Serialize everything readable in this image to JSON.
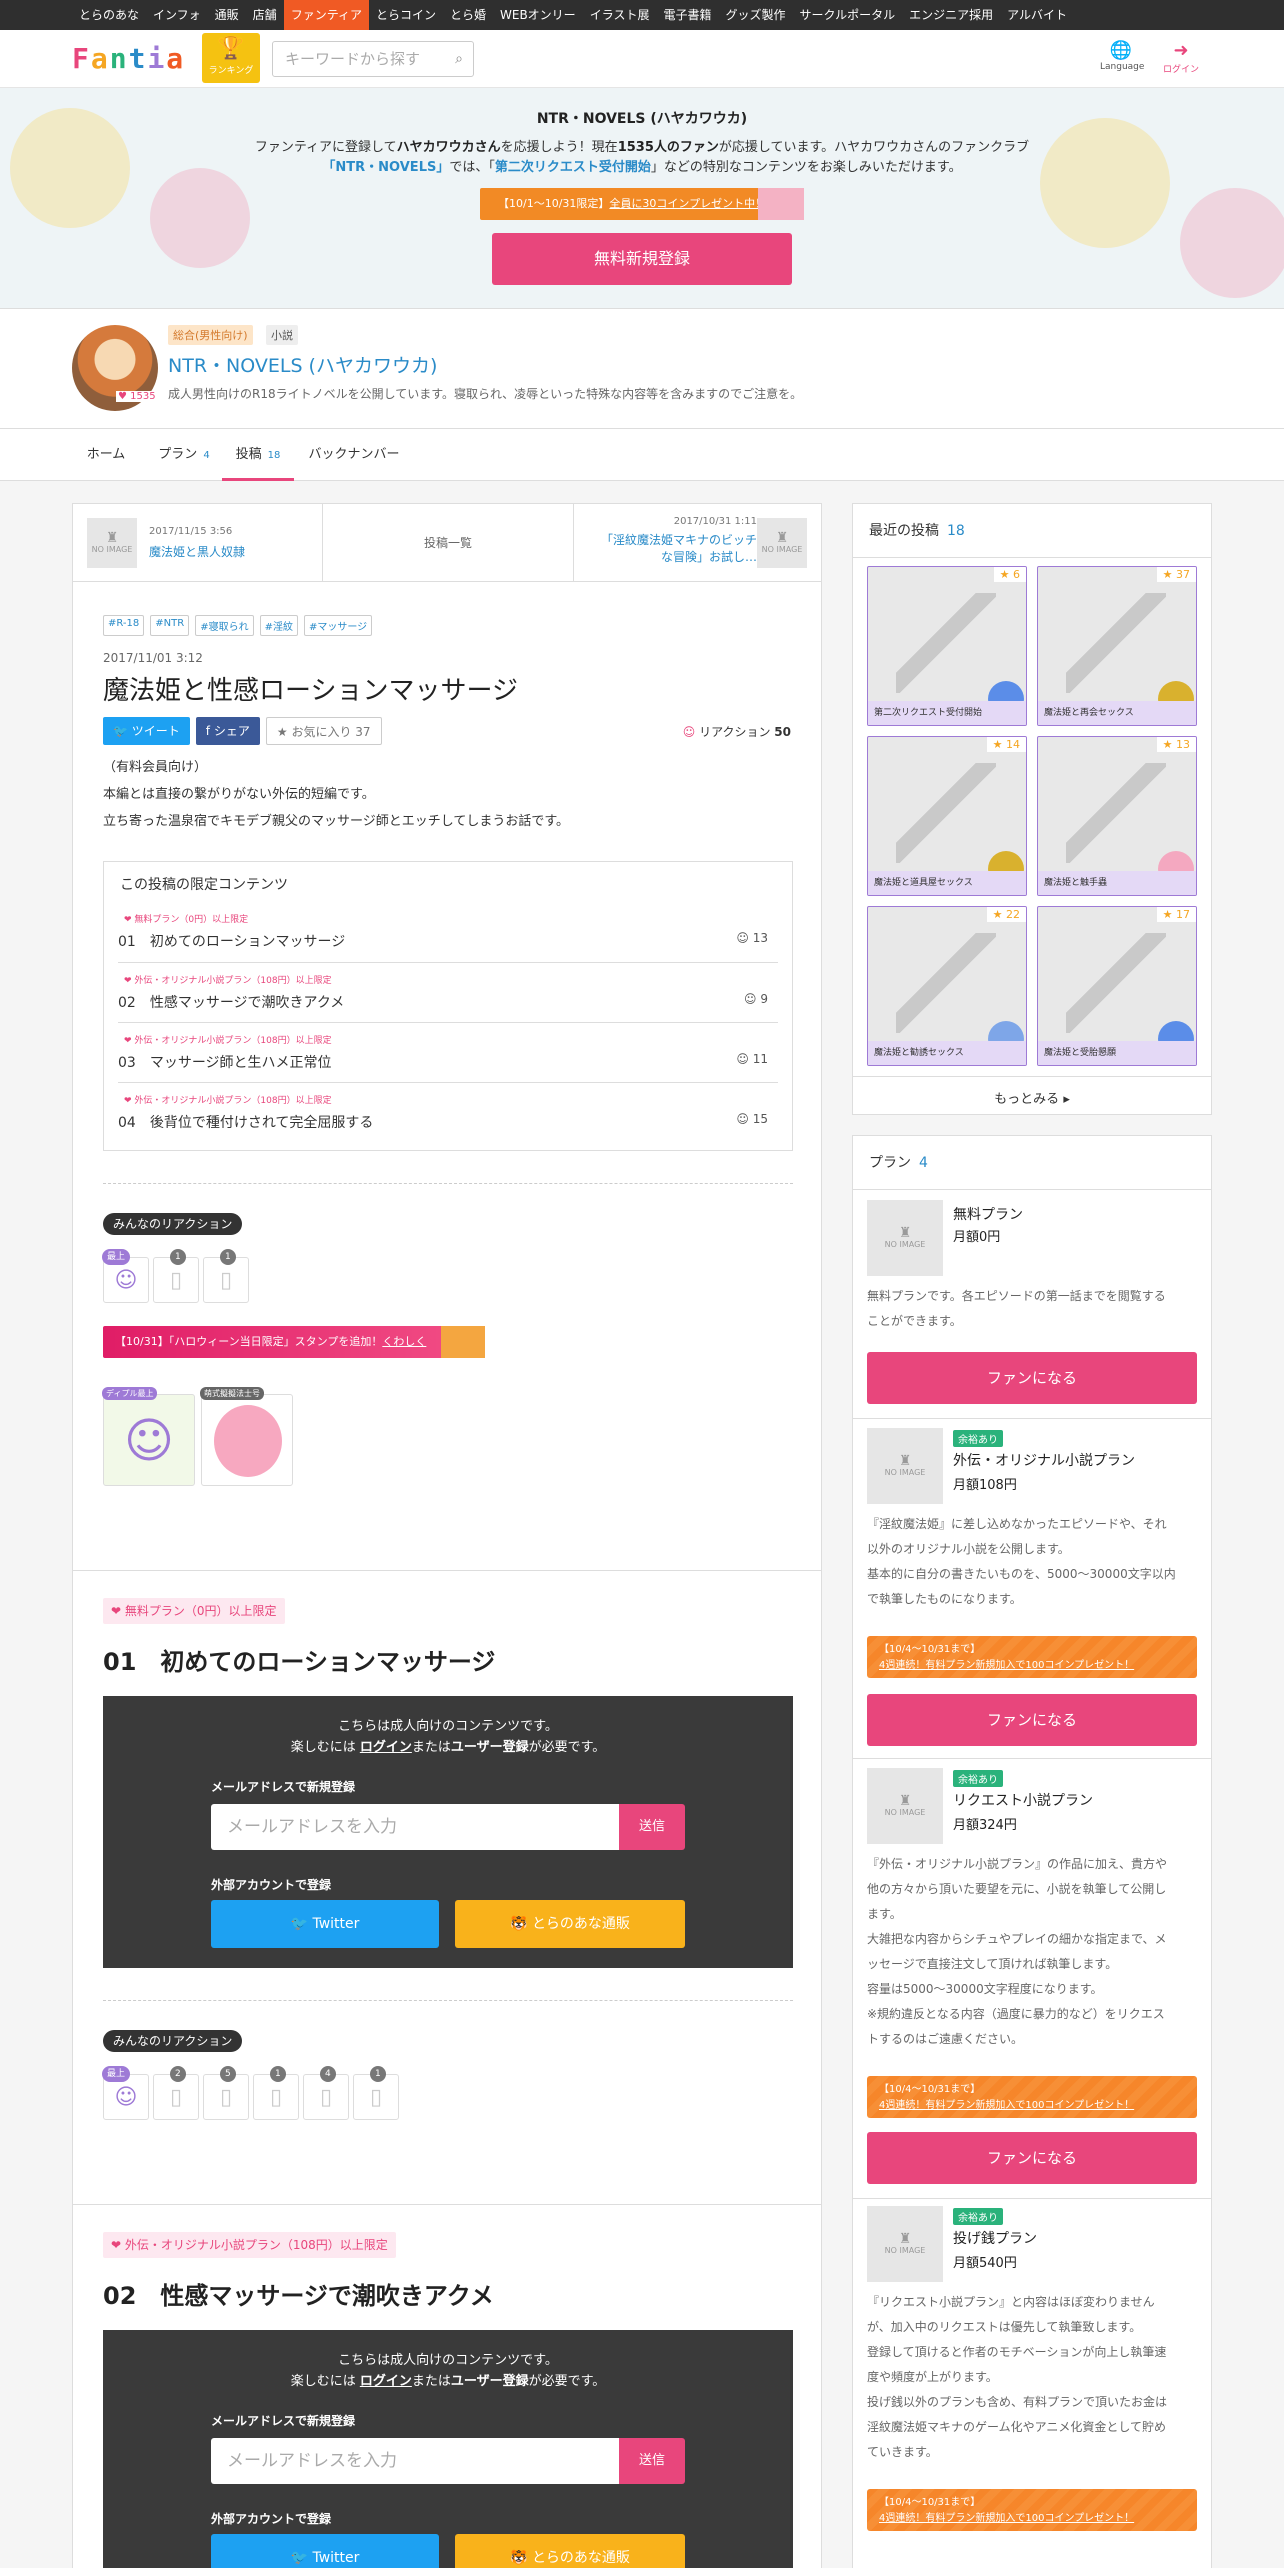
{
  "topnav": [
    "とらのあな",
    "インフォ",
    "通販",
    "店舗",
    "ファンティア",
    "とらコイン",
    "とら婚",
    "WEBオンリー",
    "イラスト展",
    "電子書籍",
    "グッズ製作",
    "サークルポータル",
    "エンジニア採用",
    "アルバイト"
  ],
  "header": {
    "logo": "Fantia",
    "ranking": "ランキング",
    "search_placeholder": "キーワードから探す",
    "language": "Language",
    "login": "ログイン"
  },
  "hero": {
    "title": "NTR・NOVELS (ハヤカワウカ)",
    "line1_a": "ファンティアに登録して",
    "line1_b": "ハヤカワウカさん",
    "line1_c": "を応援しよう！現在",
    "line1_d": "1535人のファン",
    "line1_e": "が応援しています。ハヤカワウカさんのファンクラブ",
    "line2_a": "「NTR・NOVELS」",
    "line2_b": "では、「",
    "line2_c": "第二次リクエスト受付開始",
    "line2_d": "」などの特別なコンテンツをお楽しみいただけます。",
    "campaign_a": "【10/1～10/31限定】",
    "campaign_b": "全員に30コインプレゼント中！",
    "register": "無料新規登録"
  },
  "creator": {
    "fans": "1535",
    "tag_category": "総合(男性向け)",
    "tag_sub": "小説",
    "name": "NTR・NOVELS (ハヤカワウカ)",
    "description": "成人男性向けのR18ライトノベルを公開しています。寝取られ、凌辱といった特殊な内容等を含みますのでご注意を。"
  },
  "tabs": [
    {
      "label": "ホーム",
      "count": ""
    },
    {
      "label": "プラン",
      "count": "4"
    },
    {
      "label": "投稿",
      "count": "18"
    },
    {
      "label": "バックナンバー",
      "count": ""
    }
  ],
  "post_nav": {
    "prev_date": "2017/11/15 3:56",
    "prev_title": "魔法姫と黒人奴隷",
    "center": "投稿一覧",
    "next_date": "2017/10/31 1:11",
    "next_title_1": "「淫紋魔法姫マキナのビッチ",
    "next_title_2": "な冒険」お試し…",
    "no_image": "NO IMAGE"
  },
  "post": {
    "tags": [
      "#R-18",
      "#NTR",
      "#寝取られ",
      "#淫紋",
      "#マッサージ"
    ],
    "date": "2017/11/01 3:12",
    "title": "魔法姫と性感ローションマッサージ",
    "tweet": "ツイート",
    "share": "シェア",
    "favorite": "お気に入り 37",
    "reaction_label": "リアクション",
    "reaction_count": "50",
    "body_1": "（有料会員向け）",
    "body_2": "本編とは直接の繋がりがない外伝的短編です。",
    "body_3": "立ち寄った温泉宿でキモデブ親父のマッサージ師とエッチしてしまうお話です。"
  },
  "limited": {
    "title": "この投稿の限定コンテンツ",
    "items": [
      {
        "plan": "無料プラン（0円）以上限定",
        "title": "01　初めてのローションマッサージ",
        "count": "13"
      },
      {
        "plan": "外伝・オリジナル小説プラン（108円）以上限定",
        "title": "02　性感マッサージで潮吹きアクメ",
        "count": "9"
      },
      {
        "plan": "外伝・オリジナル小説プラン（108円）以上限定",
        "title": "03　マッサージ師と生ハメ正常位",
        "count": "11"
      },
      {
        "plan": "外伝・オリジナル小説プラン（108円）以上限定",
        "title": "04　後背位で種付けされて完全屈服する",
        "count": "15"
      }
    ]
  },
  "reactions": {
    "label": "みんなのリアクション",
    "self_badge": "最上",
    "counts1": [
      "1",
      "1"
    ],
    "counts2": [
      "2",
      "5",
      "1",
      "4",
      "1"
    ]
  },
  "halloween": {
    "a": "【10/31】「ハロウィーン当日限定」スタンプを追加！",
    "b": "くわしく"
  },
  "stamps": [
    {
      "label": "ディプル最上"
    },
    {
      "label": "萌式擬擬法士号"
    }
  ],
  "sections": [
    {
      "plan": "無料プラン（0円）以上限定",
      "title": "01　初めてのローションマッサージ"
    },
    {
      "plan": "外伝・オリジナル小説プラン（108円）以上限定",
      "title": "02　性感マッサージで潮吹きアクメ"
    }
  ],
  "adult": {
    "msg_1": "こちらは成人向けのコンテンツです。",
    "msg_2a": "楽しむには ",
    "msg_2b": "ログイン",
    "msg_2c": "または",
    "msg_2d": "ユーザー登録",
    "msg_2e": "が必要です。",
    "email_label": "メールアドレスで新規登録",
    "email_placeholder": "メールアドレスを入力",
    "send": "送信",
    "external_label": "外部アカウントで登録",
    "twitter": "Twitter",
    "tora": "とらのあな通販"
  },
  "recent": {
    "title": "最近の投稿",
    "count": "18",
    "items": [
      {
        "title": "第二次リクエスト受付開始",
        "stars": "6"
      },
      {
        "title": "魔法姫と再会セックス",
        "stars": "37"
      },
      {
        "title": "魔法姫と道具屋セックス",
        "stars": "14"
      },
      {
        "title": "魔法姫と触手蟲",
        "stars": "13"
      },
      {
        "title": "魔法姫と勧誘セックス",
        "stars": "22"
      },
      {
        "title": "魔法姫と受胎懇願",
        "stars": "17"
      }
    ],
    "more": "もっとみる"
  },
  "plans": {
    "title": "プラン",
    "count": "4",
    "fan": "ファンになる",
    "vacancy": "余裕あり",
    "campaign_a": "【10/4～10/31まで】",
    "campaign_b": "4週連続！有料プラン新規加入で100コインプレゼント！",
    "items": [
      {
        "name": "無料プラン",
        "price": "月額0円",
        "desc": [
          "無料プランです。各エピソードの第一話までを閲覧する",
          "ことができます。"
        ]
      },
      {
        "name": "外伝・オリジナル小説プラン",
        "price": "月額108円",
        "desc": [
          "『淫紋魔法姫』に差し込めなかったエピソードや、それ",
          "以外のオリジナル小説を公開します。",
          "基本的に自分の書きたいものを、5000～30000文字以内",
          "で執筆したものになります。"
        ]
      },
      {
        "name": "リクエスト小説プラン",
        "price": "月額324円",
        "desc": [
          "『外伝・オリジナル小説プラン』の作品に加え、貴方や",
          "他の方々から頂いた要望を元に、小説を執筆して公開し",
          "ます。",
          "大雑把な内容からシチュやプレイの細かな指定まで、メ",
          "ッセージで直接注文して頂ければ執筆します。",
          "容量は5000～30000文字程度になります。",
          "※規約違反となる内容（過度に暴力的など）をリクエス",
          "トするのはご遠慮ください。"
        ]
      },
      {
        "name": "投げ銭プラン",
        "price": "月額540円",
        "desc": [
          "『リクエスト小説プラン』と内容はほぼ変わりません",
          "が、加入中のリクエストは優先して執筆致します。",
          "登録して頂けると作者のモチベーションが向上し執筆速",
          "度や頻度が上がります。",
          "投げ銭以外のプランも含め、有料プランで頂いたお金は",
          "淫紋魔法姫マキナのゲーム化やアニメ化資金として貯め",
          "ていきます。"
        ]
      }
    ]
  }
}
